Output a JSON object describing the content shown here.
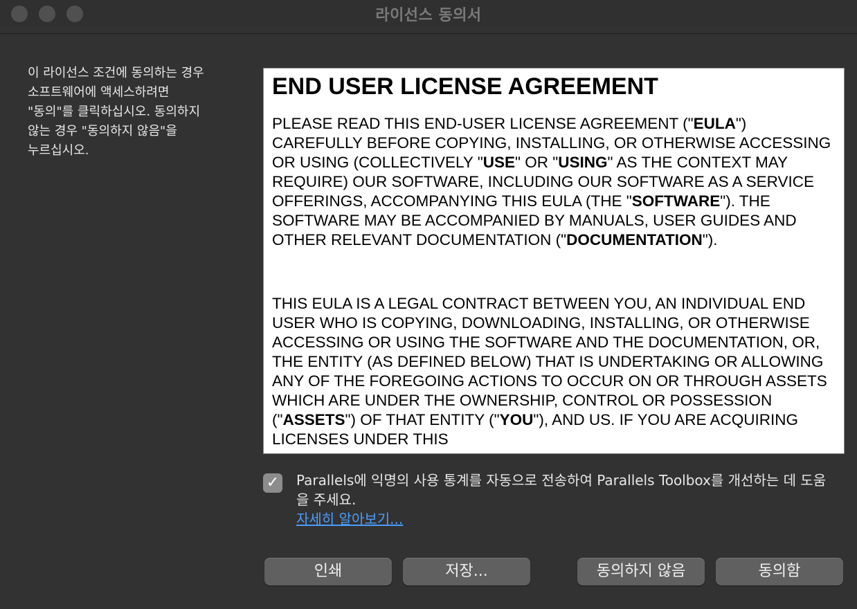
{
  "window": {
    "title": "라이선스 동의서"
  },
  "instructions": {
    "lines": [
      "이 라이선스 조건에 동의하는 경우",
      "소프트웨어에 액세스하려면",
      "\"동의\"를 클릭하십시오. 동의하지",
      "않는 경우 \"동의하지 않음\"을",
      "누르십시오."
    ]
  },
  "license": {
    "heading": "END USER LICENSE AGREEMENT",
    "p1": {
      "a": "PLEASE READ THIS END-USER LICENSE AGREEMENT (\"",
      "b_eula": "EULA",
      "c": "\") CAREFULLY BEFORE COPYING, INSTALLING, OR OTHERWISE ACCESSING OR USING (COLLECTIVELY \"",
      "b_use": "USE",
      "d": "\" OR \"",
      "b_using": "USING",
      "e": "\" AS THE CONTEXT MAY REQUIRE) OUR SOFTWARE, INCLUDING OUR SOFTWARE AS A SERVICE OFFERINGS, ACCOMPANYING THIS EULA (THE \"",
      "b_software": "SOFTWARE",
      "f": "\"). THE SOFTWARE MAY BE ACCOMPANIED BY MANUALS, USER GUIDES AND OTHER RELEVANT DOCUMENTATION (\"",
      "b_documentation": "DOCUMENTATION",
      "g": "\")."
    },
    "p2": {
      "a": "THIS EULA IS A LEGAL CONTRACT BETWEEN YOU, AN INDIVIDUAL END USER WHO IS COPYING, DOWNLOADING, INSTALLING, OR OTHERWISE ACCESSING OR USING THE SOFTWARE AND THE DOCUMENTATION, OR, THE ENTITY (AS DEFINED BELOW) THAT IS UNDERTAKING OR ALLOWING ANY OF THE FOREGOING ACTIONS TO OCCUR ON OR THROUGH ASSETS WHICH ARE UNDER THE OWNERSHIP, CONTROL OR POSSESSION (\"",
      "b_assets": "ASSETS",
      "c": "\") OF THAT ENTITY (\"",
      "b_you": "YOU",
      "d": "\"), AND US. IF YOU ARE ACQUIRING LICENSES UNDER THIS"
    }
  },
  "statistics_checkbox": {
    "checked": true,
    "check_glyph": "✓",
    "label": "Parallels에 익명의 사용 통계를 자동으로 전송하여 Parallels Toolbox를 개선하는 데 도움을 주세요.",
    "learn_more": "자세히 알아보기..."
  },
  "buttons": {
    "print": "인쇄",
    "save": "저장...",
    "disagree": "동의하지 않음",
    "agree": "동의함"
  }
}
